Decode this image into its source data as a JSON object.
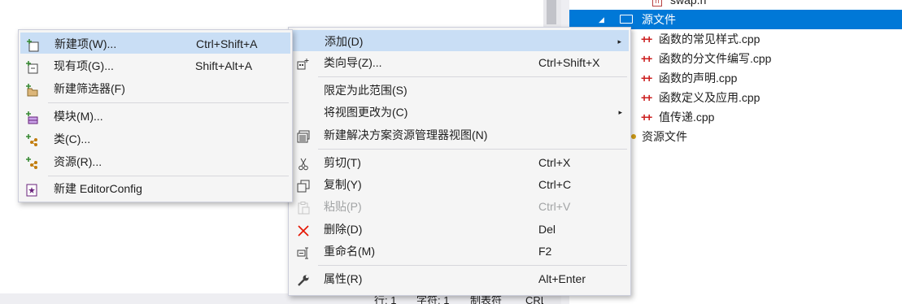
{
  "status_bar": {
    "line": "行: 1",
    "char": "字符: 1",
    "tabs": "制表符",
    "eol": "CRLF"
  },
  "explorer": {
    "top_file": "swap.h",
    "source_folder": "源文件",
    "files": [
      "函数的常见样式.cpp",
      "函数的分文件编写.cpp",
      "函数的声明.cpp",
      "函数定义及应用.cpp",
      "值传递.cpp"
    ],
    "resource_folder": "资源文件",
    "selected_color": "#0078d7"
  },
  "main_menu": {
    "items": [
      {
        "label": "添加(D)",
        "shortcut": "",
        "icon": "none",
        "submenu": true
      },
      {
        "label": "类向导(Z)...",
        "shortcut": "Ctrl+Shift+X",
        "icon": "class-wizard-icon"
      },
      {
        "label": "限定为此范围(S)",
        "shortcut": "",
        "icon": "none"
      },
      {
        "label": "将视图更改为(C)",
        "shortcut": "",
        "icon": "none",
        "submenu": true
      },
      {
        "label": "新建解决方案资源管理器视图(N)",
        "shortcut": "",
        "icon": "new-view-icon"
      },
      {
        "label": "剪切(T)",
        "shortcut": "Ctrl+X",
        "icon": "scissors-icon"
      },
      {
        "label": "复制(Y)",
        "shortcut": "Ctrl+C",
        "icon": "copy-icon"
      },
      {
        "label": "粘贴(P)",
        "shortcut": "Ctrl+V",
        "icon": "paste-icon",
        "disabled": true
      },
      {
        "label": "删除(D)",
        "shortcut": "Del",
        "icon": "delete-x-icon"
      },
      {
        "label": "重命名(M)",
        "shortcut": "F2",
        "icon": "rename-icon"
      },
      {
        "label": "属性(R)",
        "shortcut": "Alt+Enter",
        "icon": "wrench-icon"
      }
    ],
    "arrow_glyph": "▸"
  },
  "sub_menu": {
    "items": [
      {
        "label": "新建项(W)...",
        "shortcut": "Ctrl+Shift+A",
        "icon": "new-item-icon"
      },
      {
        "label": "现有项(G)...",
        "shortcut": "Shift+Alt+A",
        "icon": "existing-item-icon"
      },
      {
        "label": "新建筛选器(F)",
        "shortcut": "",
        "icon": "new-filter-icon"
      },
      {
        "label": "模块(M)...",
        "shortcut": "",
        "icon": "module-icon"
      },
      {
        "label": "类(C)...",
        "shortcut": "",
        "icon": "class-icon"
      },
      {
        "label": "资源(R)...",
        "shortcut": "",
        "icon": "resource-icon"
      },
      {
        "label": "新建 EditorConfig",
        "shortcut": "",
        "icon": "editorconfig-icon"
      }
    ]
  },
  "colors": {
    "hover": "#c9def5",
    "menu_bg": "#f5f5f5",
    "delete_red": "#e51400",
    "plus_green": "#388a34"
  }
}
